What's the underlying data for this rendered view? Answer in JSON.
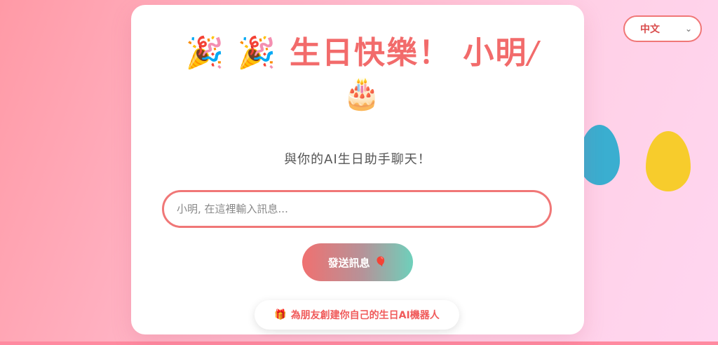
{
  "title": {
    "party_emoji_1": "🎉",
    "party_emoji_2": "🎉",
    "text": "生日快樂！ 小明",
    "slash": "/",
    "cake_emoji": "🎂"
  },
  "subtitle": "與你的AI生日助手聊天！",
  "message_input": {
    "placeholder": "小明, 在這裡輸入訊息...",
    "value": ""
  },
  "send_button": {
    "label": "發送訊息",
    "icon": "🎈"
  },
  "create_link": {
    "icon": "🎁",
    "label": "為朋友創建你自己的生日AI機器人"
  },
  "language_select": {
    "selected": "中文"
  },
  "colors": {
    "accent": "#f26b6b",
    "blue_egg": "#3aaed0",
    "yellow_egg": "#f7cc2c",
    "teal": "#6ed0bb"
  }
}
